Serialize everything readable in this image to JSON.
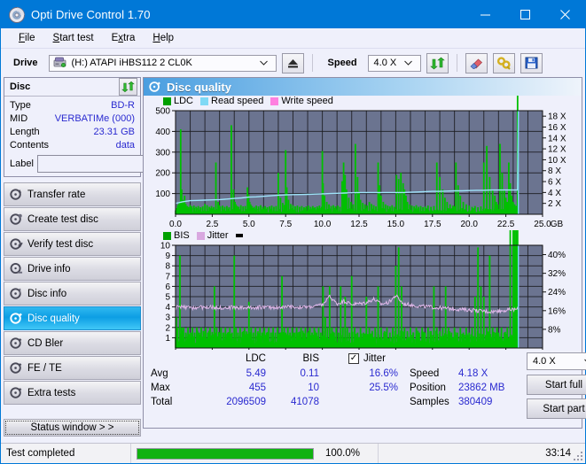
{
  "window": {
    "title": "Opti Drive Control 1.70",
    "icon": "disc-icon",
    "minimize": "–",
    "maximize": "☐",
    "close": "✕",
    "accent": "#0078d7"
  },
  "menu": [
    {
      "label": "File",
      "accel": "F"
    },
    {
      "label": "Start test",
      "accel": "S"
    },
    {
      "label": "Extra",
      "accel": "x"
    },
    {
      "label": "Help",
      "accel": "H"
    }
  ],
  "toolbar": {
    "drive_label": "Drive",
    "drive_value": "(H:)   ATAPI iHBS112  2 CL0K",
    "eject_icon": "eject-icon",
    "speed_label": "Speed",
    "speed_value": "4.0 X",
    "refresh_icon": "refresh-icon",
    "erase_icon": "erase-icon",
    "tools_icon": "tools-icon",
    "save_icon": "save-icon"
  },
  "disc_panel": {
    "title": "Disc",
    "refresh_icon": "refresh-icon",
    "rows": [
      {
        "key": "Type",
        "value": "BD-R"
      },
      {
        "key": "MID",
        "value": "VERBATIMe (000)"
      },
      {
        "key": "Length",
        "value": "23.31 GB"
      },
      {
        "key": "Contents",
        "value": "data"
      }
    ],
    "label_key": "Label",
    "label_value": "",
    "label_placeholder": "",
    "label_button_icon": "disc-icon"
  },
  "nav": {
    "items": [
      {
        "label": "Transfer rate",
        "icon": "disc-transfer-icon",
        "active": false
      },
      {
        "label": "Create test disc",
        "icon": "disc-create-icon",
        "active": false
      },
      {
        "label": "Verify test disc",
        "icon": "disc-verify-icon",
        "active": false
      },
      {
        "label": "Drive info",
        "icon": "drive-info-icon",
        "active": false
      },
      {
        "label": "Disc info",
        "icon": "disc-info-icon",
        "active": false
      },
      {
        "label": "Disc quality",
        "icon": "disc-quality-icon",
        "active": true
      },
      {
        "label": "CD Bler",
        "icon": "disc-bler-icon",
        "active": false
      },
      {
        "label": "FE / TE",
        "icon": "disc-fete-icon",
        "active": false
      },
      {
        "label": "Extra tests",
        "icon": "disc-extra-icon",
        "active": false
      }
    ],
    "status_window": "Status window > >"
  },
  "panel": {
    "title": "Disc quality",
    "icon": "disc-quality-icon"
  },
  "chart_data": [
    {
      "type": "line",
      "name": "ldc-chart",
      "title": "",
      "legend": [
        {
          "label": "LDC",
          "color": "#00a000"
        },
        {
          "label": "Read speed",
          "color": "#7fd9f5"
        },
        {
          "label": "Write speed",
          "color": "#ff80e0"
        }
      ],
      "legend_position": "top-left",
      "grid": true,
      "xlabel": "GB",
      "ylabel": "",
      "xlim": [
        0,
        25.0
      ],
      "ylim": [
        0,
        500
      ],
      "xticks": [
        "0.0",
        "2.5",
        "5.0",
        "7.5",
        "10.0",
        "12.5",
        "15.0",
        "17.5",
        "20.0",
        "22.5",
        "25.0"
      ],
      "yticks": [
        "100",
        "200",
        "300",
        "400",
        "500"
      ],
      "y2ticks": [
        "2 X",
        "4 X",
        "6 X",
        "8 X",
        "10 X",
        "12 X",
        "14 X",
        "16 X",
        "18 X"
      ],
      "y2lim": [
        0,
        19
      ],
      "series": [
        {
          "name": "LDC",
          "color": "#00c000",
          "kind": "spikes",
          "baseline": 18,
          "x": [
            0.05,
            0.15,
            0.25,
            0.35,
            0.42,
            0.5,
            0.58,
            0.62,
            0.7,
            0.8,
            0.9,
            1.0,
            1.1,
            1.25,
            1.4,
            1.55,
            1.7,
            1.85,
            2.0,
            2.15,
            2.3,
            2.45,
            2.6,
            2.75,
            2.9,
            2.97,
            3.05,
            3.2,
            3.35,
            3.5,
            3.65,
            3.8,
            3.95,
            4.05,
            4.12,
            4.2,
            4.3,
            4.45,
            4.6,
            4.75,
            4.9,
            4.97,
            5.05,
            5.12,
            5.2,
            5.35,
            5.5,
            5.65,
            5.8,
            5.95,
            6.1,
            6.25,
            6.4,
            6.55,
            6.7,
            6.85,
            7.0,
            7.15,
            7.3,
            7.42,
            7.5,
            7.58,
            7.7,
            7.85,
            8.0,
            8.15,
            8.3,
            8.45,
            8.6,
            8.75,
            8.9,
            9.05,
            9.2,
            9.35,
            9.5,
            9.65,
            9.8,
            9.95,
            10.0,
            10.05,
            10.15,
            10.3,
            10.45,
            10.6,
            10.75,
            10.9,
            11.05,
            11.2,
            11.35,
            11.45,
            11.55,
            11.65,
            11.8,
            11.95,
            12.1,
            12.25,
            12.4,
            12.5,
            12.6,
            12.75,
            12.9,
            13.05,
            13.2,
            13.35,
            13.5,
            13.65,
            13.8,
            13.9,
            14.0,
            14.15,
            14.3,
            14.45,
            14.6,
            14.75,
            14.9,
            15.05,
            15.2,
            15.35,
            15.5,
            15.6,
            15.7,
            15.8,
            15.95,
            16.1,
            16.25,
            16.4,
            16.55,
            16.7,
            16.85,
            17.0,
            17.2,
            17.4,
            17.6,
            17.8,
            18.0,
            18.2,
            18.35,
            18.5,
            18.7,
            18.9,
            19.0,
            19.1,
            19.25,
            19.4,
            19.6,
            19.8,
            20.0,
            20.2,
            20.4,
            20.6,
            20.8,
            21.0,
            21.2,
            21.4,
            21.6,
            21.75,
            21.85,
            21.95,
            22.1,
            22.25,
            22.4,
            22.5,
            22.6,
            22.7,
            22.8,
            22.9,
            23.0,
            23.1,
            23.2,
            23.3
          ],
          "y": [
            30,
            45,
            60,
            410,
            120,
            70,
            55,
            90,
            50,
            40,
            35,
            45,
            38,
            42,
            36,
            40,
            34,
            38,
            50,
            44,
            36,
            40,
            35,
            250,
            60,
            44,
            38,
            42,
            36,
            40,
            34,
            430,
            120,
            60,
            48,
            40,
            36,
            44,
            38,
            40,
            130,
            95,
            60,
            48,
            40,
            36,
            42,
            38,
            44,
            36,
            40,
            34,
            38,
            42,
            36,
            40,
            200,
            80,
            55,
            45,
            310,
            130,
            70,
            50,
            44,
            38,
            42,
            36,
            40,
            34,
            38,
            42,
            36,
            40,
            34,
            38,
            42,
            36,
            305,
            150,
            90,
            60,
            48,
            40,
            44,
            38,
            42,
            36,
            160,
            250,
            190,
            120,
            80,
            60,
            48,
            340,
            180,
            110,
            70,
            55,
            48,
            42,
            60,
            50,
            44,
            38,
            250,
            140,
            90,
            60,
            48,
            42,
            38,
            44,
            36,
            190,
            170,
            200,
            150,
            120,
            90,
            60,
            48,
            42,
            38,
            44,
            36,
            40,
            34,
            38,
            42,
            36,
            40,
            250,
            180,
            120,
            80,
            60,
            48,
            42,
            38,
            250,
            140,
            90,
            60,
            48,
            42,
            36,
            40,
            34,
            38,
            250,
            330,
            180,
            120,
            90,
            60,
            48,
            340,
            200,
            120,
            80,
            60,
            250,
            150,
            90,
            60,
            48,
            40
          ]
        },
        {
          "name": "Read speed",
          "color": "#9fe4fa",
          "kind": "line",
          "x": [
            0.0,
            0.5,
            1.0,
            1.5,
            2.0,
            2.5,
            3.0,
            3.5,
            4.0,
            4.5,
            5.0,
            5.5,
            6.0,
            6.5,
            7.0,
            7.5,
            8.0,
            8.5,
            9.0,
            9.5,
            10.0,
            10.5,
            11.0,
            11.5,
            12.0,
            12.5,
            13.0,
            13.5,
            14.0,
            14.5,
            15.0,
            15.5,
            16.0,
            16.5,
            17.0,
            17.5,
            18.0,
            18.5,
            19.0,
            19.5,
            20.0,
            20.5,
            21.0,
            21.5,
            22.0,
            22.5,
            23.0,
            23.3,
            23.35
          ],
          "y_x": [
            2.0,
            2.3,
            2.5,
            2.55,
            2.6,
            2.65,
            2.7,
            2.8,
            2.9,
            3.0,
            3.15,
            3.2,
            3.3,
            3.4,
            3.5,
            3.55,
            3.6,
            3.62,
            3.65,
            3.7,
            3.75,
            3.8,
            3.85,
            3.9,
            3.95,
            4.0,
            4.0,
            4.0,
            4.0,
            4.0,
            4.0,
            4.0,
            4.05,
            4.1,
            4.15,
            4.2,
            4.2,
            4.25,
            4.3,
            4.3,
            4.35,
            4.4,
            4.4,
            4.45,
            4.45,
            4.45,
            4.45,
            4.45,
            19.0
          ]
        }
      ]
    },
    {
      "type": "line",
      "name": "bis-jitter-chart",
      "title": "",
      "legend": [
        {
          "label": "BIS",
          "color": "#00a000"
        },
        {
          "label": "Jitter",
          "color": "#d9a8e0"
        }
      ],
      "legend_position": "top-left",
      "grid": true,
      "xlabel": "GB",
      "ylabel": "",
      "xlim": [
        0,
        25.0
      ],
      "ylim": [
        0,
        10
      ],
      "xticks": [
        "0.0",
        "2.5",
        "5.0",
        "7.5",
        "10.0",
        "12.5",
        "15.0",
        "17.5",
        "20.0",
        "22.5",
        "25.0"
      ],
      "yticks": [
        "1",
        "2",
        "3",
        "4",
        "5",
        "6",
        "7",
        "8",
        "9",
        "10"
      ],
      "y2ticks": [
        "8%",
        "16%",
        "24%",
        "32%",
        "40%"
      ],
      "y2lim": [
        0,
        44
      ],
      "series": [
        {
          "name": "BIS",
          "color": "#00c000",
          "kind": "spikes",
          "baseline": 1.0,
          "x": [
            0.05,
            0.15,
            0.3,
            0.42,
            0.55,
            0.7,
            0.85,
            1.0,
            1.15,
            1.3,
            1.45,
            1.6,
            1.75,
            1.9,
            2.05,
            2.2,
            2.35,
            2.5,
            2.65,
            2.8,
            2.97,
            3.1,
            3.25,
            3.4,
            3.55,
            3.7,
            3.85,
            4.0,
            4.12,
            4.25,
            4.4,
            4.55,
            4.7,
            4.85,
            5.0,
            5.15,
            5.3,
            5.45,
            5.6,
            5.75,
            5.9,
            6.05,
            6.2,
            6.35,
            6.5,
            6.65,
            6.8,
            6.95,
            7.1,
            7.25,
            7.4,
            7.5,
            7.65,
            7.8,
            7.95,
            8.1,
            8.25,
            8.4,
            8.55,
            8.7,
            8.85,
            9.0,
            9.15,
            9.3,
            9.45,
            9.6,
            9.75,
            9.9,
            10.05,
            10.2,
            10.35,
            10.5,
            10.65,
            10.8,
            10.95,
            11.1,
            11.25,
            11.4,
            11.55,
            11.7,
            11.85,
            12.0,
            12.2,
            12.4,
            12.6,
            12.8,
            13.0,
            13.2,
            13.4,
            13.6,
            13.8,
            14.0,
            14.2,
            14.4,
            14.6,
            14.8,
            15.0,
            15.2,
            15.4,
            15.6,
            15.8,
            16.0,
            16.2,
            16.4,
            16.6,
            16.8,
            17.0,
            17.2,
            17.4,
            17.6,
            17.8,
            18.0,
            18.2,
            18.4,
            18.6,
            18.8,
            19.0,
            19.2,
            19.4,
            19.6,
            19.8,
            20.0,
            20.2,
            20.4,
            20.6,
            20.8,
            21.0,
            21.2,
            21.4,
            21.6,
            21.8,
            21.9,
            22.0,
            22.2,
            22.4,
            22.6,
            22.8,
            23.0,
            23.1,
            23.2,
            23.3
          ],
          "y": [
            3,
            2,
            9,
            2,
            2,
            1.5,
            2,
            1.5,
            2,
            1.5,
            2,
            1.5,
            2,
            1.5,
            2,
            1.5,
            2,
            1.5,
            6,
            2,
            1.5,
            2,
            1.5,
            2,
            1.5,
            2,
            1.5,
            9,
            2,
            1.5,
            2,
            1.5,
            2,
            1.5,
            4.5,
            2,
            1.5,
            2,
            1.5,
            2,
            1.5,
            2,
            1.5,
            2,
            1.5,
            2,
            1.5,
            2,
            1.5,
            7,
            2,
            1.5,
            2,
            1.5,
            2,
            1.5,
            2,
            1.5,
            2,
            1.5,
            2,
            1.5,
            2,
            1.5,
            2,
            1.5,
            2,
            1.5,
            6,
            3,
            2,
            6,
            2,
            1.5,
            2,
            1.5,
            6,
            2,
            5,
            2,
            1.5,
            7,
            2,
            1.5,
            2,
            1.5,
            5,
            2,
            1.5,
            2,
            6,
            2,
            1.5,
            2,
            1.5,
            2,
            8,
            9.8,
            6,
            2,
            1.5,
            2,
            1.5,
            2,
            1.5,
            2,
            1.5,
            2,
            1.5,
            6,
            2,
            1.5,
            2,
            6,
            2,
            1.5,
            2,
            1.5,
            2,
            1.5,
            2,
            1.5,
            2,
            5,
            9.8,
            6,
            5,
            2,
            9,
            2,
            1.5,
            2,
            1.5,
            2,
            1.5,
            2
          ]
        },
        {
          "name": "Jitter",
          "color": "#e0b8ea",
          "kind": "line",
          "x": [
            0.2,
            1.0,
            2.0,
            3.0,
            4.0,
            5.0,
            6.0,
            7.0,
            8.0,
            9.0,
            10.0,
            10.5,
            11.0,
            11.5,
            12.0,
            12.5,
            13.0,
            13.5,
            14.0,
            14.5,
            15.0,
            15.5,
            16.0,
            16.5,
            17.0,
            17.5,
            18.0,
            18.5,
            19.0,
            19.5,
            20.0,
            20.5,
            21.0,
            21.5,
            22.0,
            22.5,
            23.0,
            23.3
          ],
          "y_pct": [
            17.5,
            17.2,
            17.5,
            17.3,
            17.4,
            17.3,
            17.5,
            17.4,
            17.6,
            17.5,
            18.5,
            22.0,
            19.0,
            20.0,
            18.8,
            19.0,
            19.5,
            21.0,
            18.8,
            19.5,
            22.5,
            19.0,
            18.5,
            18.0,
            17.8,
            17.5,
            17.2,
            17.0,
            16.8,
            16.5,
            16.3,
            16.0,
            15.8,
            15.6,
            15.8,
            16.2,
            16.5,
            16.6
          ]
        }
      ]
    }
  ],
  "stats": {
    "col_ldc": "LDC",
    "col_bis": "BIS",
    "rows": [
      {
        "label": "Avg",
        "ldc": "5.49",
        "bis": "0.11"
      },
      {
        "label": "Max",
        "ldc": "455",
        "bis": "10"
      },
      {
        "label": "Total",
        "ldc": "2096509",
        "bis": "41078"
      }
    ],
    "jitter_label": "Jitter",
    "jitter_checked": true,
    "jitter_check_glyph": "✓",
    "jitter_avg": "16.6%",
    "jitter_max": "25.5%",
    "speed_label": "Speed",
    "speed_value": "4.18 X",
    "position_label": "Position",
    "position_value": "23862 MB",
    "samples_label": "Samples",
    "samples_value": "380409",
    "speed_select": "4.0 X",
    "start_full": "Start full",
    "start_part": "Start part"
  },
  "statusbar": {
    "message": "Test completed",
    "progress_percent": 100,
    "percent_text": "100.0%",
    "elapsed": "33:14",
    "progress_color": "#11b211"
  }
}
